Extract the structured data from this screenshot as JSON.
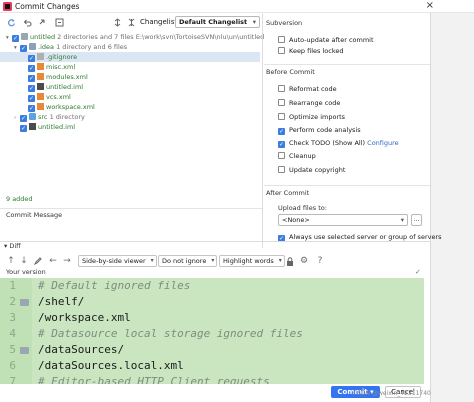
{
  "window": {
    "title": "Commit Changes",
    "close": "×"
  },
  "toolbar": {
    "changelist_label": "Changelist:",
    "changelist_value": "Default Changelist",
    "icons": [
      "refresh-icon",
      "rollback-icon",
      "diff-icon",
      "group-icon",
      "expand-all-icon",
      "collapse-all-icon"
    ]
  },
  "tree": {
    "root": {
      "name": "untitled",
      "info": "2 directories and 7 files",
      "path": "E:\\work\\svn\\TortoiseSVN\\nlu\\un\\untitled"
    },
    "idea": {
      "name": ".idea",
      "info": "1 directory and 6 files"
    },
    "files": [
      ".gitignore",
      "misc.xml",
      "modules.xml",
      "untitled.iml",
      "vcs.xml",
      "workspace.xml"
    ],
    "src": {
      "name": "src",
      "info": "1 directory"
    },
    "root_file": "untitled.iml",
    "status": "9 added"
  },
  "subversion": {
    "title": "Subversion",
    "options": [
      {
        "label": "Auto-update after commit",
        "checked": false
      },
      {
        "label": "Keep files locked",
        "checked": false
      }
    ]
  },
  "before_commit": {
    "title": "Before Commit",
    "options": [
      {
        "label": "Reformat code",
        "checked": false
      },
      {
        "label": "Rearrange code",
        "checked": false
      },
      {
        "label": "Optimize imports",
        "checked": false
      },
      {
        "label": "Perform code analysis",
        "checked": true
      },
      {
        "label": "Check TODO (Show All)",
        "checked": true,
        "link": "Configure"
      },
      {
        "label": "Cleanup",
        "checked": false
      },
      {
        "label": "Update copyright",
        "checked": false
      }
    ]
  },
  "after_commit": {
    "title": "After Commit",
    "upload_label": "Upload files to:",
    "upload_value": "<None>",
    "upload_more": "...",
    "always_use": "Always use selected server or group of servers"
  },
  "commit_message": {
    "label": "Commit Message"
  },
  "diff": {
    "label": "Diff",
    "viewer": "Side-by-side viewer",
    "ignore": "Do not ignore",
    "highlight": "Highlight words",
    "version_label": "Your version",
    "lines": [
      {
        "n": "1",
        "text": "# Default ignored files",
        "kind": "comment"
      },
      {
        "n": "2",
        "text": "/shelf/",
        "kind": "code"
      },
      {
        "n": "3",
        "text": "/workspace.xml",
        "kind": "code"
      },
      {
        "n": "4",
        "text": "# Datasource local storage ignored files",
        "kind": "comment"
      },
      {
        "n": "5",
        "text": "/dataSources/",
        "kind": "code"
      },
      {
        "n": "6",
        "text": "/dataSources.local.xml",
        "kind": "code"
      },
      {
        "n": "7",
        "text": "# Editor-based HTTP Client requests",
        "kind": "comment"
      }
    ]
  },
  "footer": {
    "commit": "Commit",
    "cancel": "Cancel",
    "watermark": "CSDN @weixin_42311740"
  },
  "colors": {
    "accent": "#3574f0",
    "diff_bg": "#c9e6c0",
    "added_text": "#2d7a2d"
  }
}
